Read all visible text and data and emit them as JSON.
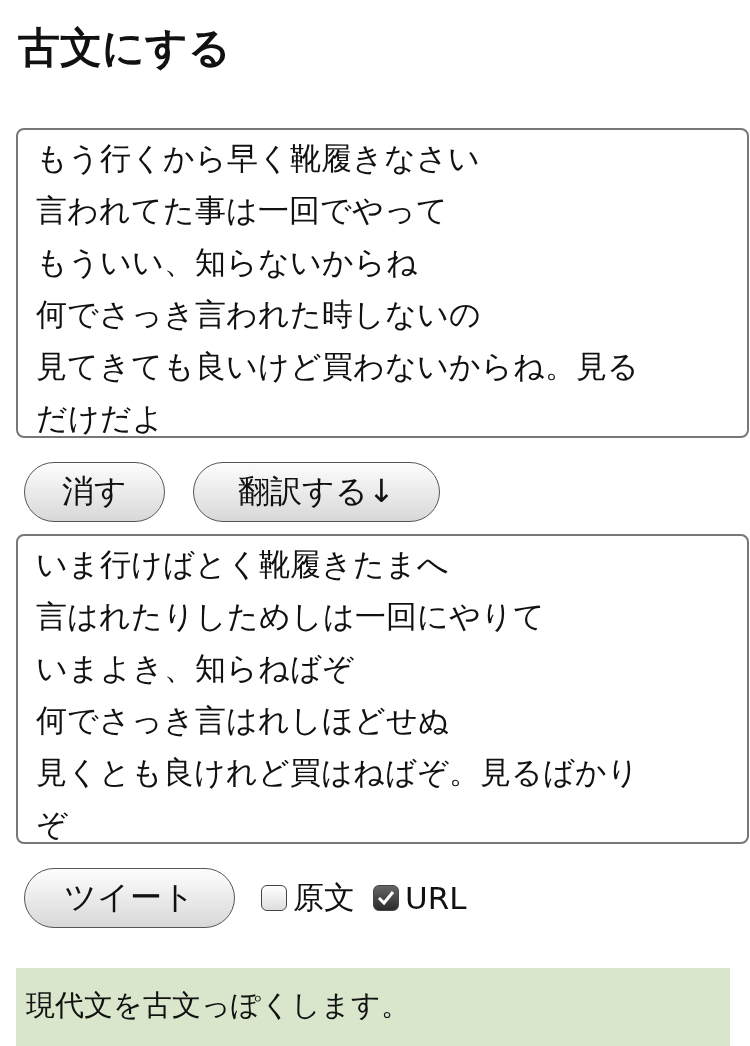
{
  "title": "古文にする",
  "input": {
    "lines": [
      "もう行くから早く靴履きなさい",
      "言われてた事は一回でやって",
      "もういい、知らないからね",
      "何でさっき言われた時しないの",
      "見てきても良いけど買わないからね。見る",
      "だけだよ"
    ]
  },
  "buttons": [
    "消す",
    "翻訳する↓"
  ],
  "output": {
    "lines": [
      "いま行けばとく靴履きたまへ",
      "言はれたりしためしは一回にやりて",
      "いまよき、知らねばぞ",
      "何でさっき言はれしほどせぬ",
      "見くとも良けれど買はねばぞ。見るばかり",
      "ぞ"
    ]
  },
  "tweet_button": "ツイート",
  "options": [
    {
      "label": "原文",
      "checked": false
    },
    {
      "label": "URL",
      "checked": true
    }
  ],
  "description": "現代文を古文っぽくします。"
}
